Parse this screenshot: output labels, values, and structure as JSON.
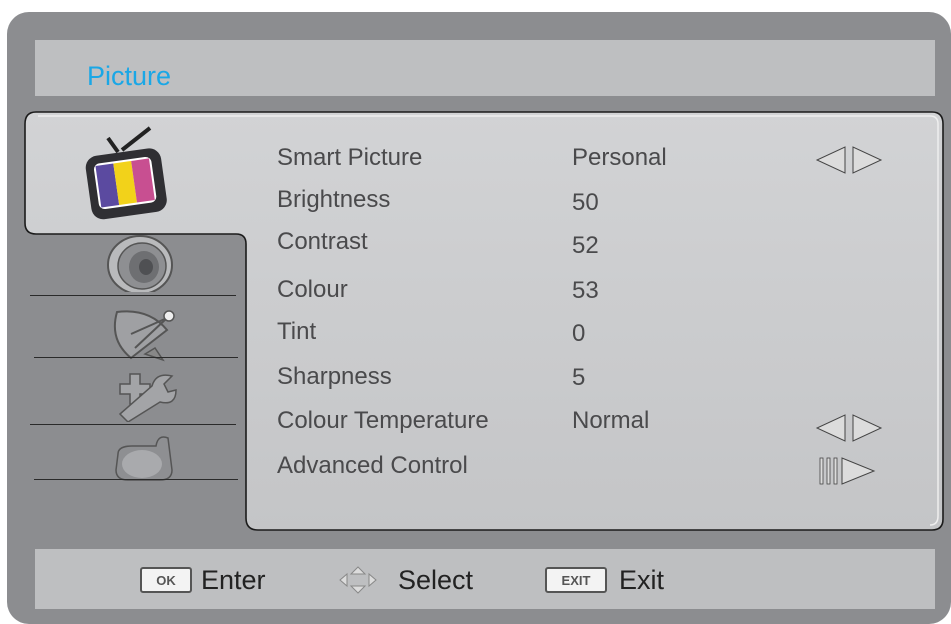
{
  "header": {
    "title": "Picture"
  },
  "sidebar": {
    "items": [
      {
        "icon": "tv-icon",
        "selected": true
      },
      {
        "icon": "speaker-icon",
        "selected": false
      },
      {
        "icon": "satellite-dish-icon",
        "selected": false
      },
      {
        "icon": "tools-icon",
        "selected": false
      },
      {
        "icon": "lock-icon",
        "selected": false
      }
    ]
  },
  "menu": {
    "items": [
      {
        "label": "Smart Picture",
        "value": "Personal",
        "control": "left-right-arrows"
      },
      {
        "label": "Brightness",
        "value": "50"
      },
      {
        "label": "Contrast",
        "value": "52"
      },
      {
        "label": "Colour",
        "value": "53"
      },
      {
        "label": "Tint",
        "value": "0"
      },
      {
        "label": "Sharpness",
        "value": "5"
      },
      {
        "label": "Colour Temperature",
        "value": "Normal",
        "control": "left-right-arrows"
      },
      {
        "label": "Advanced Control",
        "value": "",
        "control": "enter-arrow"
      }
    ]
  },
  "footer": {
    "ok_key": "OK",
    "enter_label": "Enter",
    "select_label": "Select",
    "exit_key": "EXIT",
    "exit_label": "Exit"
  },
  "colors": {
    "frame": "#8c8d90",
    "panel": "#c8c9cb",
    "title": "#1aa7e6",
    "text": "#4a4a4c"
  }
}
